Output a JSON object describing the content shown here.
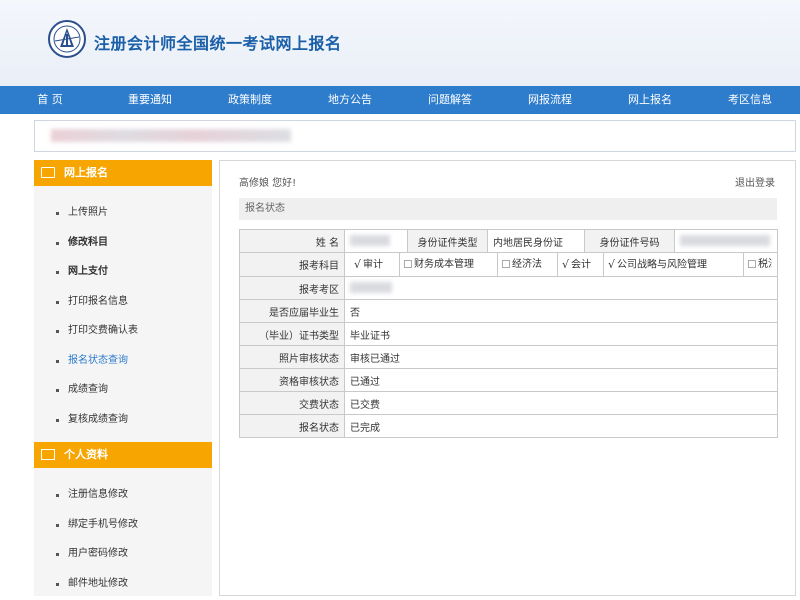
{
  "header": {
    "title": "注册会计师全国统一考试网上报名",
    "logo_icon": "cicpa-logo-icon"
  },
  "nav": {
    "items": [
      "首 页",
      "重要通知",
      "政策制度",
      "地方公告",
      "问题解答",
      "网报流程",
      "网上报名",
      "考区信息"
    ]
  },
  "sidebar": {
    "section1": {
      "title": "网上报名",
      "items": [
        "上传照片",
        "修改科目",
        "网上支付",
        "打印报名信息",
        "打印交费确认表",
        "报名状态查询",
        "成绩查询",
        "复核成绩查询"
      ]
    },
    "section2": {
      "title": "个人资料",
      "items": [
        "注册信息修改",
        "绑定手机号修改",
        "用户密码修改",
        "邮件地址修改"
      ]
    }
  },
  "main": {
    "greeting": "高修娘 您好!",
    "logout": "退出登录",
    "section_title": "报名状态",
    "table": {
      "name_label": "姓 名",
      "id_type_label": "身份证件类型",
      "id_type_value": "内地居民身份证",
      "id_number_label": "身份证件号码",
      "subjects_label": "报考科目",
      "subjects": [
        {
          "name": "审计",
          "checked": true
        },
        {
          "name": "财务成本管理",
          "checked": false
        },
        {
          "name": "经济法",
          "checked": false
        },
        {
          "name": "会计",
          "checked": true
        },
        {
          "name": "公司战略与风险管理",
          "checked": true
        },
        {
          "name": "税法",
          "checked": false
        }
      ],
      "rows": [
        {
          "label": "报考考区",
          "value": ""
        },
        {
          "label": "是否应届毕业生",
          "value": "否"
        },
        {
          "label": "（毕业）证书类型",
          "value": "毕业证书"
        },
        {
          "label": "照片审核状态",
          "value": "审核已通过"
        },
        {
          "label": "资格审核状态",
          "value": "已通过"
        },
        {
          "label": "交费状态",
          "value": "已交费"
        },
        {
          "label": "报名状态",
          "value": "已完成"
        }
      ]
    }
  },
  "colors": {
    "nav_bg": "#2e7ccc",
    "sidebar_head": "#f7a500",
    "title_blue": "#1a5fa8",
    "active_link": "#2e7ccc"
  }
}
